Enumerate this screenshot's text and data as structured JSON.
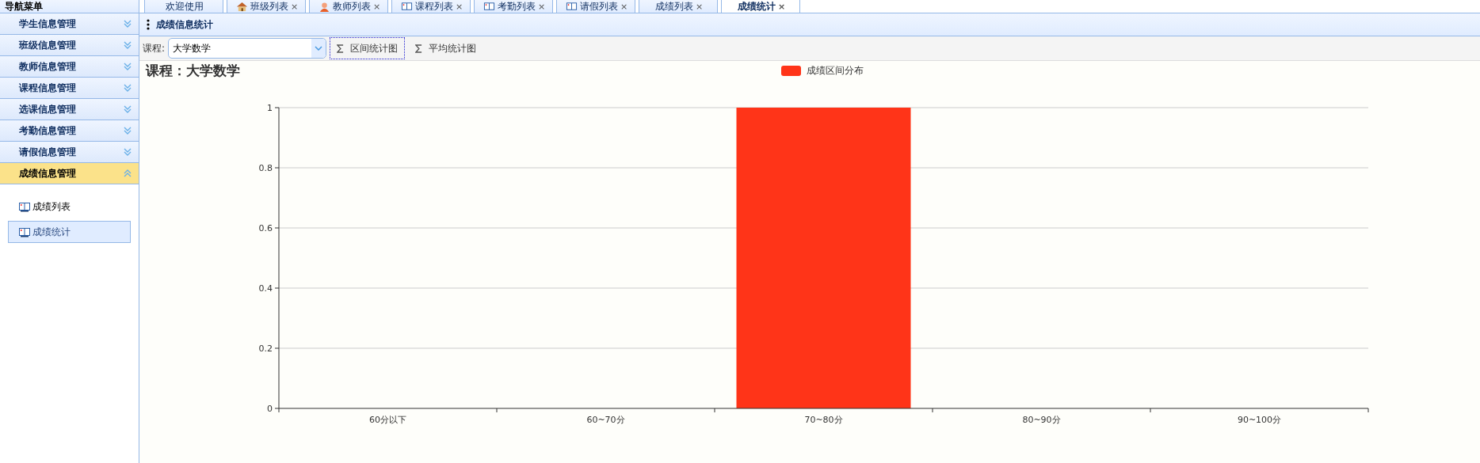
{
  "sidebar": {
    "title": "导航菜单",
    "items": [
      {
        "label": "学生信息管理",
        "expanded": false
      },
      {
        "label": "班级信息管理",
        "expanded": false
      },
      {
        "label": "教师信息管理",
        "expanded": false
      },
      {
        "label": "课程信息管理",
        "expanded": false
      },
      {
        "label": "选课信息管理",
        "expanded": false
      },
      {
        "label": "考勤信息管理",
        "expanded": false
      },
      {
        "label": "请假信息管理",
        "expanded": false
      },
      {
        "label": "成绩信息管理",
        "expanded": true,
        "children": [
          {
            "label": "成绩列表",
            "selected": false
          },
          {
            "label": "成绩统计",
            "selected": true
          }
        ]
      }
    ]
  },
  "tabs": [
    {
      "label": "欢迎使用",
      "kind": "plain",
      "selected": false
    },
    {
      "label": "班级列表",
      "kind": "house",
      "close": "×",
      "selected": false
    },
    {
      "label": "教师列表",
      "kind": "person",
      "close": "×",
      "selected": false
    },
    {
      "label": "课程列表",
      "kind": "book",
      "close": "×",
      "selected": false
    },
    {
      "label": "考勤列表",
      "kind": "book",
      "close": "×",
      "selected": false
    },
    {
      "label": "请假列表",
      "kind": "book",
      "close": "×",
      "selected": false
    },
    {
      "label": "成绩列表",
      "kind": "plain",
      "close": "×",
      "selected": false
    },
    {
      "label": "成绩统计",
      "kind": "plain",
      "close": "×",
      "selected": true
    }
  ],
  "panel": {
    "title": "成绩信息统计"
  },
  "toolbar": {
    "course_label": "课程:",
    "course_value": "大学数学",
    "buttons": [
      {
        "label": "区间统计图",
        "focused": true
      },
      {
        "label": "平均统计图",
        "focused": false
      }
    ]
  },
  "chart_data": {
    "type": "bar",
    "title": "课程：大学数学",
    "categories": [
      "60分以下",
      "60~70分",
      "70~80分",
      "80~90分",
      "90~100分"
    ],
    "series": [
      {
        "name": "成绩区间分布",
        "color": "#ff3418",
        "values": [
          0,
          0,
          1,
          0,
          0
        ]
      }
    ],
    "ylim": [
      0,
      1
    ],
    "yticks": [
      0,
      0.2,
      0.4,
      0.6,
      0.8,
      1
    ],
    "grid": true
  }
}
